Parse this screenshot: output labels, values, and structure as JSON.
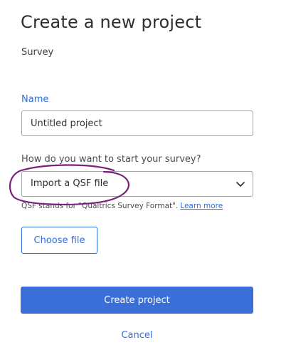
{
  "dialog": {
    "title": "Create a new project",
    "subtitle": "Survey"
  },
  "name_field": {
    "label": "Name",
    "value": "Untitled project"
  },
  "start_field": {
    "label": "How do you want to start your survey?",
    "selected": "Import a QSF file",
    "helper_text": "QSF stands for \"Qualtrics Survey Format\".",
    "learn_more_label": "Learn more"
  },
  "buttons": {
    "choose_file": "Choose file",
    "create_project": "Create project",
    "cancel": "Cancel"
  },
  "colors": {
    "accent": "#2f6ee0",
    "primary_button": "#3a6fd8",
    "annotation": "#7a1f7d"
  },
  "icons": {
    "select_chevron": "chevron-down-icon"
  }
}
